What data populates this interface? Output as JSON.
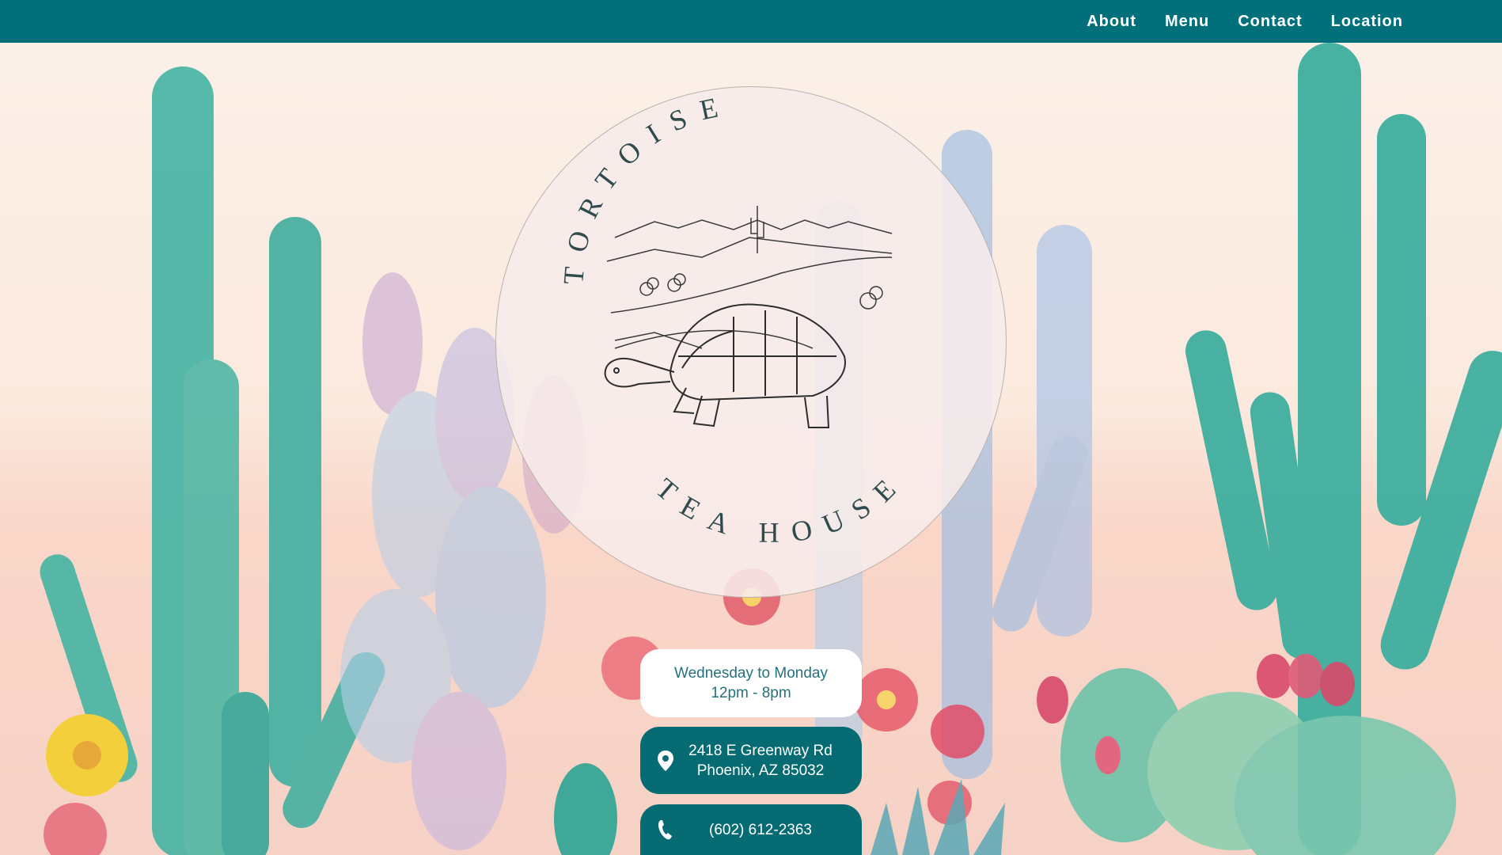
{
  "nav": {
    "items": [
      "About",
      "Menu",
      "Contact",
      "Location"
    ]
  },
  "logo": {
    "top_text": "TORTOISE",
    "bottom_text": "TEA HOUSE"
  },
  "hours": {
    "days": "Wednesday to Monday",
    "time": "12pm - 8pm"
  },
  "address": {
    "line1": "2418 E Greenway Rd",
    "line2": "Phoenix, AZ 85032",
    "icon": "map-pin-icon"
  },
  "phone": {
    "number": "(602) 612-2363",
    "icon": "phone-icon"
  },
  "colors": {
    "nav_bg": "#02707a",
    "accent": "#076b73",
    "background": "#fbeee6",
    "cactus_teal": "#4fb8a8"
  }
}
